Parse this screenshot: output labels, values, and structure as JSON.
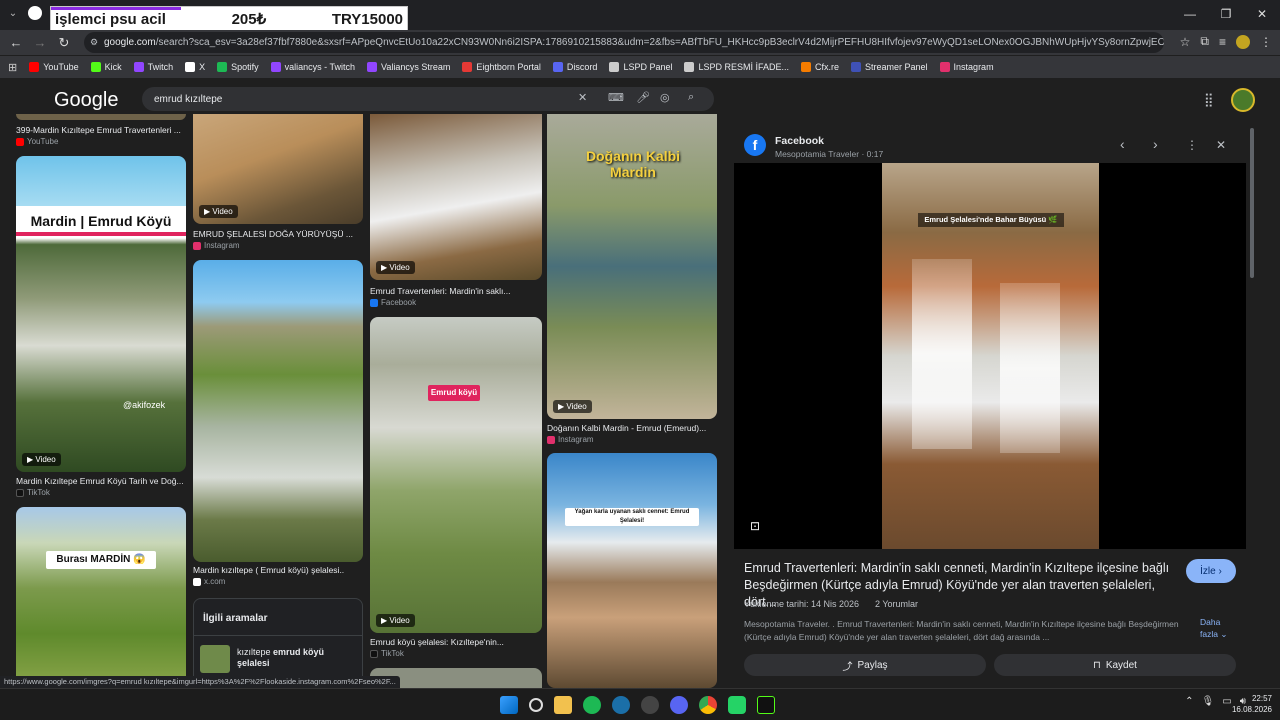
{
  "overlay": {
    "left": "işlemci psu acil",
    "mid": "205₺",
    "right": "TRY15000"
  },
  "window": {
    "minimize": "—",
    "restore": "❐",
    "close": "✕"
  },
  "address": {
    "url_prefix": "google.com",
    "url_rest": "/search?sca_esv=3a28ef37fbf7880e&sxsrf=APpeQnvcEtUo10a22xCN93W0Nn6i2ISPA:1786910215883&udm=2&fbs=ABfTbFU_HKHcc9pB3eclrV4d2MijrPEFHU8HIfvfojev97eWyQD1seLONex0OGJBNhWUpHjvYSy8ornZpwjEOW3scRcAyH9..."
  },
  "bookmarks": [
    {
      "label": "YouTube",
      "color": "#ff0000"
    },
    {
      "label": "Kick",
      "color": "#53fc18"
    },
    {
      "label": "Twitch",
      "color": "#9146ff"
    },
    {
      "label": "X",
      "color": "#ffffff"
    },
    {
      "label": "Spotify",
      "color": "#1db954"
    },
    {
      "label": "valiancys - Twitch",
      "color": "#9146ff"
    },
    {
      "label": "Valiancys Stream",
      "color": "#9146ff"
    },
    {
      "label": "Eightborn Portal",
      "color": "#e53935"
    },
    {
      "label": "Discord",
      "color": "#5865f2"
    },
    {
      "label": "LSPD Panel",
      "color": "#cccccc"
    },
    {
      "label": "LSPD RESMİ İFADE...",
      "color": "#cccccc"
    },
    {
      "label": "Cfx.re",
      "color": "#f57c00"
    },
    {
      "label": "Streamer Panel",
      "color": "#3f51b5"
    },
    {
      "label": "Instagram",
      "color": "#e1306c"
    }
  ],
  "google": {
    "logo": "Google",
    "query": "emrud kızıltepe"
  },
  "grid": {
    "c1_top_caption": "399-Mardin Kızıltepe Emrud Travertenleri ...",
    "c1_top_source": "YouTube",
    "mardin_banner": "Mardin | Emrud Köyü",
    "watermark": "@akifozek",
    "video_label": "Video",
    "c1_card2_caption": "Mardin Kızıltepe Emrud Köyü Tarih ve Doğ...",
    "c1_card2_source": "TikTok",
    "burasi_label": "Burası MARDİN 😱",
    "c2_card1_caption": "EMRUD ŞELALESİ DOĞA YÜRÜYÜŞÜ ...",
    "c2_card1_source": "Instagram",
    "c2_card2_caption": "Mardin kızıltepe ( Emrud köyü) şelalesi..",
    "c2_card2_source": "x.com",
    "c3_card1_caption": "Emrud Travertenleri: Mardin'in saklı...",
    "c3_card1_source": "Facebook",
    "emrud_tag": "Emrud köyü",
    "c3_card2_caption": "Emrud köyü şelalesi: Kızıltepe'nin...",
    "c3_card2_source": "TikTok",
    "dogan_label": "Doğanın Kalbi Mardin",
    "c4_card1_caption": "Doğanın Kalbi Mardin - Emrud (Emerud)...",
    "c4_card1_source": "Instagram",
    "yagan_label": "Yağan karla uyanan saklı cennet: Emrud Şelalesi!"
  },
  "related": {
    "title": "İlgili aramalar",
    "item_plain": "kızıltepe ",
    "item_bold": "emrud köyü şelalesi"
  },
  "panel": {
    "source": "Facebook",
    "subtitle": "Mesopotamia Traveler · 0:17",
    "frame_caption": "Emrud Şelalesi'nde Bahar Büyüsü 🌿",
    "title": "Emrud Travertenleri: Mardin'in saklı cenneti, Mardin'in Kızıltepe ilçesine bağlı Beşdeğirmen (Kürtçe adıyla Emrud) Köyü'nde yer alan traverten şelaleleri, dört...",
    "watch_label": "İzle",
    "upload": "Yüklenme tarihi: 14 Nis 2026",
    "comments": "2 Yorumlar",
    "desc": "Mesopotamia Traveler. . Emrud Travertenleri: Mardin'in saklı cenneti, Mardin'in Kızıltepe ilçesine bağlı Beşdeğirmen (Kürtçe adıyla Emrud) Köyü'nde yer alan traverten şelaleleri, dört dağ arasında ...",
    "more": "Daha fazla",
    "share": "Paylaş",
    "save": "Kaydet"
  },
  "status_url": "https://www.google.com/imgres?q=emrud kızıltepe&imgurl=https%3A%2F%2Flookaside.instagram.com%2Fseo%2F...",
  "clock": {
    "time": "22:57",
    "date": "16.08.2026"
  }
}
